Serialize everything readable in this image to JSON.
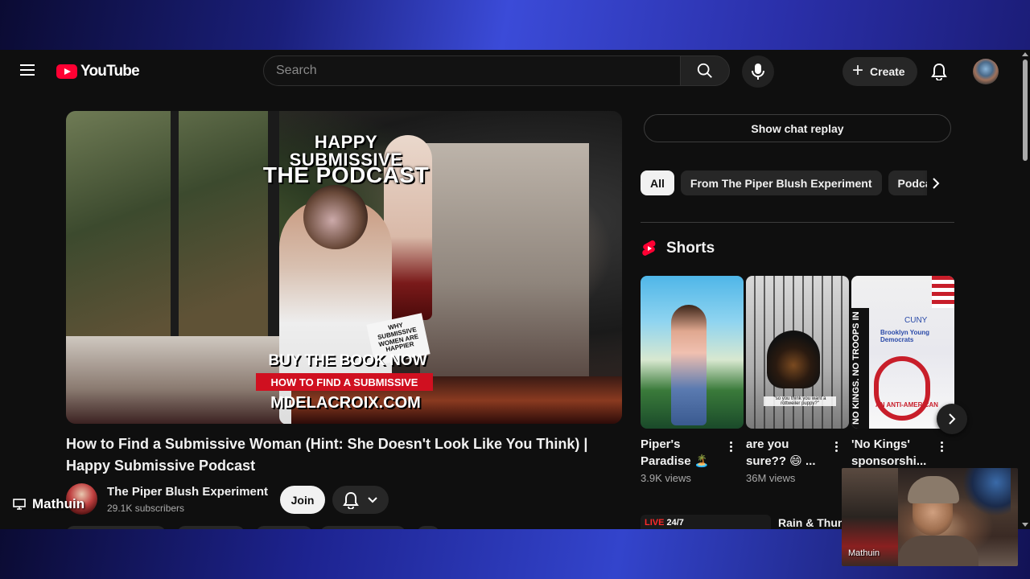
{
  "header": {
    "logo_text": "YouTube",
    "search_placeholder": "Search",
    "create_label": "Create"
  },
  "video": {
    "overlay_title_small": "HAPPY SUBMISSIVE",
    "overlay_title_big": "THE PODCAST",
    "book_sign": "WHY SUBMISSIVE WOMEN ARE HAPPIER",
    "buy_book": "BUY THE BOOK NOW",
    "find_bar": "HOW TO FIND A SUBMISSIVE",
    "site_url": "MDELACROIX.COM",
    "title": "How to Find a Submissive Woman (Hint: She Doesn't Look Like You Think) | Happy Submissive Podcast"
  },
  "owner": {
    "channel_name": "The Piper Blush Experiment",
    "subscribers": "29.1K subscribers",
    "join_label": "Join"
  },
  "sidebar": {
    "chat_replay": "Show chat replay",
    "chips": [
      {
        "label": "All",
        "active": true
      },
      {
        "label": "From The Piper Blush Experiment",
        "active": false
      },
      {
        "label": "Podcasts",
        "active": false
      }
    ],
    "shorts_title": "Shorts",
    "shorts": [
      {
        "title": "Piper's Paradise 🏝️",
        "views": "3.9K views"
      },
      {
        "title": "are you sure?? 😄 ...",
        "views": "36M views",
        "caption": "\"so you think you want a rottweiler puppy?\""
      },
      {
        "title": "'No Kings' sponsorshi...",
        "views": "",
        "strip": "NO KINGS. NO TROOPS IN",
        "cuny": "CUNY",
        "org": "Brooklyn Young Democrats",
        "anti": "AN ANTI-AMERICAN"
      }
    ],
    "live_badge_live": "LIVE",
    "live_badge_rest": " 24/7",
    "live_title": "Rain & Thunder"
  },
  "stream": {
    "streamer_name": "Mathuin",
    "webcam_label": "Mathuin"
  },
  "colors": {
    "brand_red": "#ff0033",
    "page_bg": "#0f0f0f",
    "chip_bg": "#272727"
  }
}
